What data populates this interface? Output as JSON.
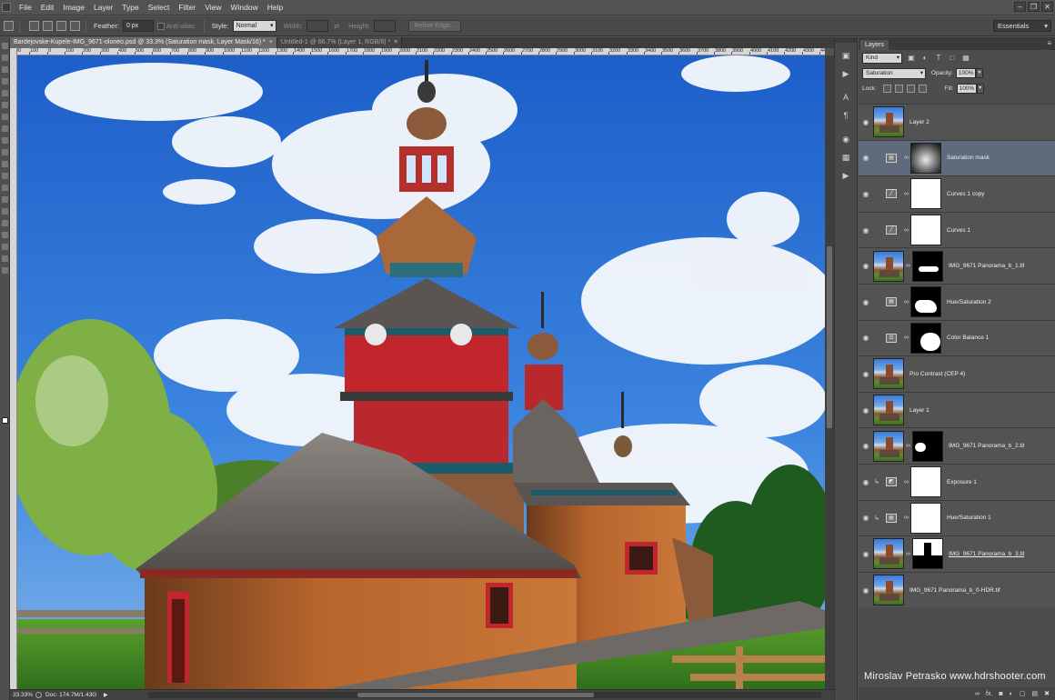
{
  "menu": [
    "File",
    "Edit",
    "Image",
    "Layer",
    "Type",
    "Select",
    "Filter",
    "View",
    "Window",
    "Help"
  ],
  "window_controls": [
    "–",
    "❐",
    "✕"
  ],
  "options": {
    "feather_label": "Feather:",
    "feather_value": "0 px",
    "antialias_label": "Anti-alias",
    "style_label": "Style:",
    "style_value": "Normal",
    "width_label": "Width:",
    "height_label": "Height:",
    "refine_edge": "Refine Edge..."
  },
  "workspace": "Essentials",
  "tabs": [
    {
      "label": "Bardejovske-Kupele-IMG_9671-oloneo.psd @ 33.3% (Saturation mask, Layer Mask/16) *",
      "close": "×",
      "active": true
    },
    {
      "label": "Untitled-1 @ 66.7% (Layer 1, RGB/8) *",
      "close": "×",
      "active": false
    }
  ],
  "ruler_marks": [
    "200",
    "100",
    "0",
    "100",
    "200",
    "300",
    "400",
    "500",
    "600",
    "700",
    "800",
    "900",
    "1000",
    "1100",
    "1200",
    "1300",
    "1400",
    "1500",
    "1600",
    "1700",
    "1800",
    "1900",
    "2000",
    "2100",
    "2200",
    "2300",
    "2400",
    "2500",
    "2600",
    "2700",
    "2800",
    "2900",
    "3000",
    "3100",
    "3200",
    "3300",
    "3400",
    "3500",
    "3600",
    "3700",
    "3800",
    "3900",
    "4000",
    "4100",
    "4200",
    "4300",
    "4400"
  ],
  "status": {
    "zoom": "33.33%",
    "doc": "Doc: 174.7M/1.43G",
    "arrow": "▶"
  },
  "panel": {
    "tab": "Layers",
    "menu_icon": "≡",
    "kind": "Kind",
    "blend_mode": "Saturation",
    "opacity_label": "Opacity:",
    "opacity_value": "100%",
    "lock_label": "Lock:",
    "fill_label": "Fill:",
    "fill_value": "100%",
    "footer_icons": [
      "∞",
      "fx.",
      "◙",
      "◐",
      "▢",
      "▤",
      "✖"
    ]
  },
  "layers": [
    {
      "name": "Layer 2",
      "kind": "pixel",
      "thumb": "photo"
    },
    {
      "name": "Saturation mask",
      "kind": "adjustment",
      "adj_icon": "▤",
      "mask": "grey",
      "selected": true
    },
    {
      "name": "Curves 1 copy",
      "kind": "adjustment",
      "adj_icon": "╱",
      "mask": "white"
    },
    {
      "name": "Curves 1",
      "kind": "adjustment",
      "adj_icon": "╱",
      "mask": "white"
    },
    {
      "name": "IMG_9671 Panorama_b_1.tif",
      "kind": "pixel-mask",
      "thumb": "photo",
      "mask": "blob1"
    },
    {
      "name": "Hue/Saturation 2",
      "kind": "adjustment",
      "adj_icon": "▤",
      "mask": "blob2"
    },
    {
      "name": "Color Balance 1",
      "kind": "adjustment",
      "adj_icon": "⚖",
      "mask": "blob3"
    },
    {
      "name": "Pro Contrast (CEP 4)",
      "kind": "pixel",
      "thumb": "photo"
    },
    {
      "name": "Layer 1",
      "kind": "pixel",
      "thumb": "photo"
    },
    {
      "name": "IMG_9671 Panorama_b_2.tif",
      "kind": "pixel-mask",
      "thumb": "photo",
      "mask": "blob4"
    },
    {
      "name": "Exposure 1",
      "kind": "adjustment-clipped",
      "adj_icon": "◩",
      "mask": "white"
    },
    {
      "name": "Hue/Saturation 1",
      "kind": "adjustment-clipped",
      "adj_icon": "▤",
      "mask": "white"
    },
    {
      "name": "IMG_9671 Panorama_b_3.tif",
      "kind": "pixel-mask",
      "thumb": "photo",
      "mask": "blob5",
      "underline": true
    },
    {
      "name": "IMG_9671 Panorama_b_0-HDR.tif",
      "kind": "pixel",
      "thumb": "photo"
    }
  ],
  "watermark": "Miroslav  Petrasko  www.hdrshooter.com",
  "colors": {
    "sky": "#2f6fd0",
    "church_red": "#c0262c",
    "wood": "#b5692f",
    "roof": "#6f6a66",
    "selection": "#5f6a7d"
  }
}
